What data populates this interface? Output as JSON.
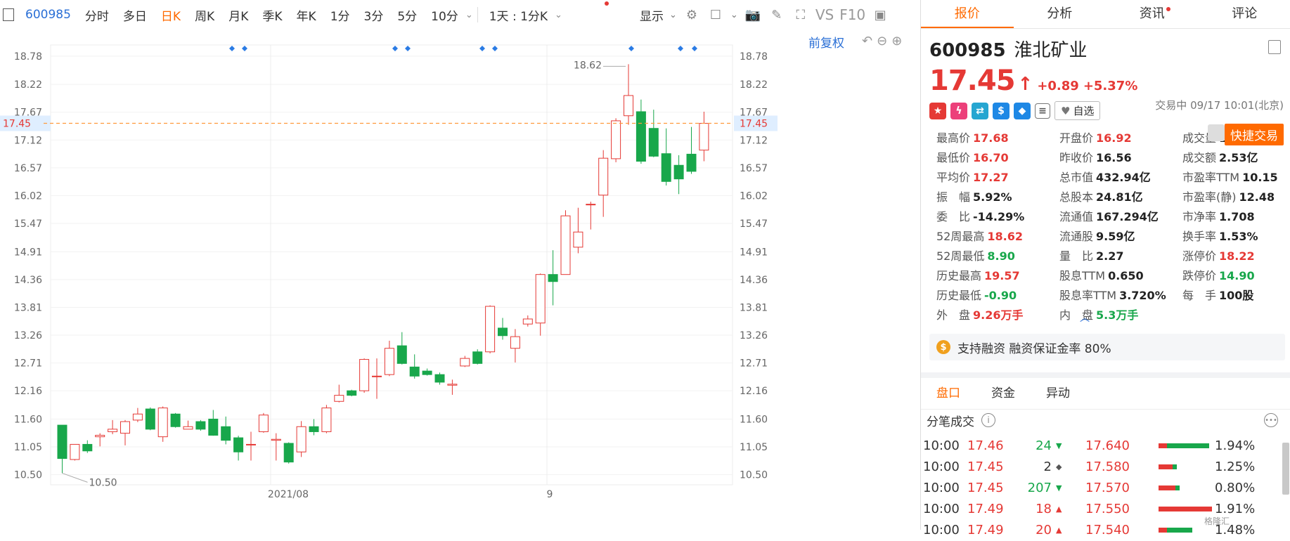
{
  "toolbar": {
    "code": "600985",
    "tabs": [
      "分时",
      "多日",
      "日K",
      "周K",
      "月K",
      "季K",
      "年K",
      "1分",
      "3分",
      "5分",
      "10分"
    ],
    "active_tab": "日K",
    "range_select": "1天 : 1分K",
    "display": "显示",
    "vs": "VS",
    "f10": "F10"
  },
  "chart": {
    "adjust_label": "前复权",
    "price_ticks": [
      "18.78",
      "18.22",
      "17.67",
      "17.12",
      "16.57",
      "16.02",
      "15.47",
      "14.91",
      "14.36",
      "13.81",
      "13.26",
      "12.71",
      "12.16",
      "11.60",
      "11.05",
      "10.50"
    ],
    "current_price_label": "17.45",
    "x_labels": [
      "2021/08",
      "9"
    ],
    "high_label": "18.62",
    "low_label": "10.50"
  },
  "chart_data": {
    "type": "candlestick",
    "ylim": [
      10.3,
      19.0
    ],
    "last_price": 17.45,
    "x_tick_labels": [
      "2021/08",
      "9"
    ],
    "candles": [
      {
        "o": 11.48,
        "c": 10.82,
        "h": 11.48,
        "l": 10.53
      },
      {
        "o": 10.8,
        "c": 11.1,
        "h": 11.1,
        "l": 10.78
      },
      {
        "o": 11.1,
        "c": 10.97,
        "h": 11.18,
        "l": 10.93
      },
      {
        "o": 11.25,
        "c": 11.28,
        "h": 11.32,
        "l": 11.06
      },
      {
        "o": 11.35,
        "c": 11.4,
        "h": 11.58,
        "l": 11.3
      },
      {
        "o": 11.32,
        "c": 11.55,
        "h": 11.58,
        "l": 11.08
      },
      {
        "o": 11.58,
        "c": 11.7,
        "h": 11.82,
        "l": 11.54
      },
      {
        "o": 11.8,
        "c": 11.4,
        "h": 11.83,
        "l": 11.38
      },
      {
        "o": 11.25,
        "c": 11.82,
        "h": 11.85,
        "l": 11.15
      },
      {
        "o": 11.7,
        "c": 11.45,
        "h": 11.72,
        "l": 11.43
      },
      {
        "o": 11.4,
        "c": 11.45,
        "h": 11.57,
        "l": 11.4
      },
      {
        "o": 11.55,
        "c": 11.4,
        "h": 11.58,
        "l": 11.37
      },
      {
        "o": 11.6,
        "c": 11.28,
        "h": 11.78,
        "l": 11.27
      },
      {
        "o": 11.45,
        "c": 11.18,
        "h": 11.65,
        "l": 11.1
      },
      {
        "o": 11.23,
        "c": 10.95,
        "h": 11.27,
        "l": 10.78
      },
      {
        "o": 11.1,
        "c": 11.1,
        "h": 11.35,
        "l": 10.78
      },
      {
        "o": 11.35,
        "c": 11.68,
        "h": 11.72,
        "l": 11.33
      },
      {
        "o": 11.18,
        "c": 11.2,
        "h": 11.32,
        "l": 10.78
      },
      {
        "o": 11.12,
        "c": 10.75,
        "h": 11.14,
        "l": 10.72
      },
      {
        "o": 10.95,
        "c": 11.45,
        "h": 11.56,
        "l": 10.85
      },
      {
        "o": 11.45,
        "c": 11.35,
        "h": 11.6,
        "l": 11.28
      },
      {
        "o": 11.35,
        "c": 11.82,
        "h": 11.88,
        "l": 11.32
      },
      {
        "o": 11.95,
        "c": 12.07,
        "h": 12.28,
        "l": 11.93
      },
      {
        "o": 12.16,
        "c": 12.07,
        "h": 12.18,
        "l": 12.05
      },
      {
        "o": 12.16,
        "c": 12.78,
        "h": 12.8,
        "l": 12.12
      },
      {
        "o": 12.45,
        "c": 12.45,
        "h": 12.8,
        "l": 12.0
      },
      {
        "o": 12.48,
        "c": 13.0,
        "h": 13.15,
        "l": 12.45
      },
      {
        "o": 13.05,
        "c": 12.7,
        "h": 13.32,
        "l": 12.68
      },
      {
        "o": 12.63,
        "c": 12.45,
        "h": 12.88,
        "l": 12.4
      },
      {
        "o": 12.55,
        "c": 12.48,
        "h": 12.6,
        "l": 12.46
      },
      {
        "o": 12.48,
        "c": 12.33,
        "h": 12.52,
        "l": 12.28
      },
      {
        "o": 12.27,
        "c": 12.29,
        "h": 12.38,
        "l": 12.08
      },
      {
        "o": 12.65,
        "c": 12.8,
        "h": 12.85,
        "l": 12.63
      },
      {
        "o": 12.93,
        "c": 12.7,
        "h": 12.98,
        "l": 12.68
      },
      {
        "o": 12.93,
        "c": 13.83,
        "h": 13.85,
        "l": 12.9
      },
      {
        "o": 13.4,
        "c": 13.25,
        "h": 13.6,
        "l": 13.17
      },
      {
        "o": 13.0,
        "c": 13.23,
        "h": 13.38,
        "l": 12.72
      },
      {
        "o": 13.48,
        "c": 13.58,
        "h": 13.65,
        "l": 13.43
      },
      {
        "o": 13.5,
        "c": 14.46,
        "h": 14.48,
        "l": 13.25
      },
      {
        "o": 14.46,
        "c": 14.32,
        "h": 14.94,
        "l": 13.85
      },
      {
        "o": 14.46,
        "c": 15.62,
        "h": 15.73,
        "l": 14.46
      },
      {
        "o": 15.0,
        "c": 15.3,
        "h": 15.78,
        "l": 14.88
      },
      {
        "o": 15.85,
        "c": 15.85,
        "h": 15.9,
        "l": 15.35
      },
      {
        "o": 16.03,
        "c": 16.76,
        "h": 16.92,
        "l": 15.6
      },
      {
        "o": 16.75,
        "c": 17.5,
        "h": 17.55,
        "l": 16.68
      },
      {
        "o": 17.6,
        "c": 18.0,
        "h": 18.62,
        "l": 17.42
      },
      {
        "o": 17.68,
        "c": 16.7,
        "h": 17.92,
        "l": 16.65
      },
      {
        "o": 17.35,
        "c": 16.8,
        "h": 17.72,
        "l": 16.78
      },
      {
        "o": 16.85,
        "c": 16.3,
        "h": 17.35,
        "l": 16.22
      },
      {
        "o": 16.62,
        "c": 16.35,
        "h": 16.82,
        "l": 16.05
      },
      {
        "o": 16.84,
        "c": 16.5,
        "h": 17.38,
        "l": 16.45
      },
      {
        "o": 16.92,
        "c": 17.45,
        "h": 17.68,
        "l": 16.7
      }
    ],
    "event_markers_x": [
      1,
      2,
      7,
      8,
      10,
      11,
      15,
      17,
      18
    ]
  },
  "quote": {
    "code": "600985",
    "name": "淮北矿业",
    "price": "17.45",
    "change": "+0.89",
    "change_pct": "+5.37%",
    "trade_time": "交易中 09/17 10:01(北京)",
    "watch": "自选",
    "fast_trade": "快捷交易"
  },
  "tabs": [
    "报价",
    "分析",
    "资讯",
    "评论"
  ],
  "stats": [
    {
      "label": "最高价",
      "value": "17.68",
      "tone": "up"
    },
    {
      "label": "开盘价",
      "value": "16.92",
      "tone": "up"
    },
    {
      "label": "成交量",
      "value": "14.67万手",
      "tone": "nt"
    },
    {
      "label": "最低价",
      "value": "16.70",
      "tone": "up"
    },
    {
      "label": "昨收价",
      "value": "16.56",
      "tone": "nt"
    },
    {
      "label": "成交额",
      "value": "2.53亿",
      "tone": "nt"
    },
    {
      "label": "平均价",
      "value": "17.27",
      "tone": "up"
    },
    {
      "label": "总市值",
      "value": "432.94亿",
      "tone": "nt"
    },
    {
      "label": "市盈率TTM",
      "value": "10.15",
      "tone": "nt"
    },
    {
      "label": "振　幅",
      "value": "5.92%",
      "tone": "nt"
    },
    {
      "label": "总股本",
      "value": "24.81亿",
      "tone": "nt"
    },
    {
      "label": "市盈率(静)",
      "value": "12.48",
      "tone": "nt"
    },
    {
      "label": "委　比",
      "value": "-14.29%",
      "tone": "nt"
    },
    {
      "label": "流通值",
      "value": "167.294亿",
      "tone": "nt"
    },
    {
      "label": "市净率",
      "value": "1.708",
      "tone": "nt"
    },
    {
      "label": "52周最高",
      "value": "18.62",
      "tone": "up"
    },
    {
      "label": "流通股",
      "value": "9.59亿",
      "tone": "nt"
    },
    {
      "label": "换手率",
      "value": "1.53%",
      "tone": "nt"
    },
    {
      "label": "52周最低",
      "value": "8.90",
      "tone": "dn"
    },
    {
      "label": "量　比",
      "value": "2.27",
      "tone": "nt"
    },
    {
      "label": "涨停价",
      "value": "18.22",
      "tone": "up"
    },
    {
      "label": "历史最高",
      "value": "19.57",
      "tone": "up"
    },
    {
      "label": "股息TTM",
      "value": "0.650",
      "tone": "nt"
    },
    {
      "label": "跌停价",
      "value": "14.90",
      "tone": "dn"
    },
    {
      "label": "历史最低",
      "value": "-0.90",
      "tone": "dn"
    },
    {
      "label": "股息率TTM",
      "value": "3.720%",
      "tone": "nt"
    },
    {
      "label": "每　手",
      "value": "100股",
      "tone": "nt"
    },
    {
      "label": "外　盘",
      "value": "9.26万手",
      "tone": "up"
    },
    {
      "label": "内　盘",
      "value": "5.3万手",
      "tone": "dn"
    },
    {
      "label": "",
      "value": "",
      "tone": "nt"
    }
  ],
  "margin_note": "支持融资 融资保证金率 80%",
  "sub_tabs": [
    "盘口",
    "资金",
    "异动"
  ],
  "ticks_title": "分笔成交",
  "ticks": [
    {
      "time": "10:00",
      "price": "17.46",
      "vol": "24",
      "dir": "down",
      "book_price": "17.640",
      "pct": "1.94%",
      "fill": 0.9
    },
    {
      "time": "10:00",
      "price": "17.45",
      "vol": "2",
      "dir": "flat",
      "book_price": "17.580",
      "pct": "1.25%",
      "fill": 0.25
    },
    {
      "time": "10:00",
      "price": "17.45",
      "vol": "207",
      "dir": "down",
      "book_price": "17.570",
      "pct": "0.80%",
      "fill": 0.3
    },
    {
      "time": "10:00",
      "price": "17.49",
      "vol": "18",
      "dir": "up",
      "book_price": "17.550",
      "pct": "1.91%",
      "fill": 0.95
    },
    {
      "time": "10:00",
      "price": "17.49",
      "vol": "20",
      "dir": "up",
      "book_price": "17.540",
      "pct": "1.48%",
      "fill": 0.6
    }
  ],
  "watermark": "格隆汇"
}
